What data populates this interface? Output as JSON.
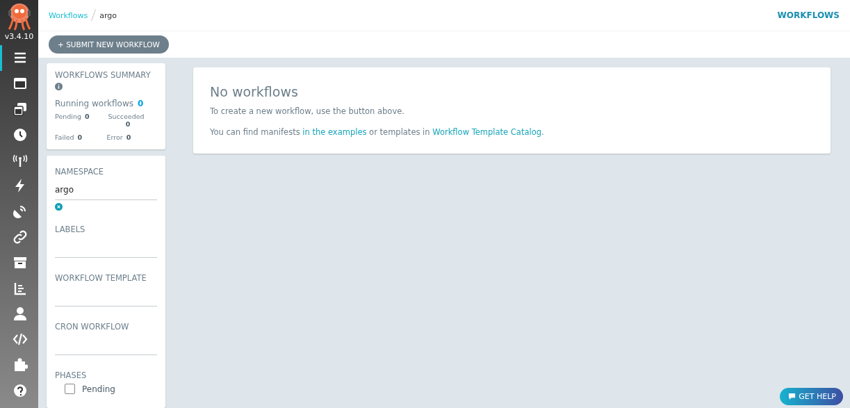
{
  "app": {
    "version": "v3.4.10"
  },
  "nav": [
    {
      "selected": true
    },
    {
      "selected": false
    },
    {
      "selected": false
    },
    {
      "selected": false
    },
    {
      "selected": false
    },
    {
      "selected": false
    },
    {
      "selected": false
    },
    {
      "selected": false
    },
    {
      "selected": false
    },
    {
      "selected": false
    },
    {
      "selected": false
    },
    {
      "selected": false
    },
    {
      "selected": false
    },
    {
      "selected": false
    }
  ],
  "breadcrumbs": [
    {
      "label": "Workflows",
      "kind": "link"
    },
    {
      "label": "argo",
      "kind": "current"
    }
  ],
  "page_title": "WORKFLOWS",
  "toolbar": {
    "submit_button": "+ SUBMIT NEW WORKFLOW"
  },
  "summary": {
    "title": "WORKFLOWS SUMMARY",
    "running_label": "Running workflows",
    "running_count": "0",
    "stats": [
      {
        "label": "Pending",
        "value": "0"
      },
      {
        "label": "Succeeded",
        "value": "0"
      },
      {
        "label": "Failed",
        "value": "0"
      },
      {
        "label": "Error",
        "value": "0"
      }
    ]
  },
  "filters": {
    "namespace": {
      "label": "NAMESPACE",
      "value": "argo"
    },
    "labels": {
      "label": "LABELS"
    },
    "workflow_template": {
      "label": "WORKFLOW TEMPLATE"
    },
    "cron_workflow": {
      "label": "CRON WORKFLOW"
    },
    "phases": {
      "label": "PHASES",
      "items": [
        {
          "label": "Pending",
          "checked": false
        }
      ]
    }
  },
  "empty_state": {
    "title": "No workflows",
    "line1": "To create a new workflow, use the button above.",
    "line2": [
      {
        "kind": "text",
        "text": "You can find manifests "
      },
      {
        "kind": "link",
        "text": "in the examples"
      },
      {
        "kind": "text",
        "text": " or templates in "
      },
      {
        "kind": "link",
        "text": "Workflow Template Catalog"
      },
      {
        "kind": "text",
        "text": "."
      }
    ]
  },
  "help_button": "GET HELP"
}
